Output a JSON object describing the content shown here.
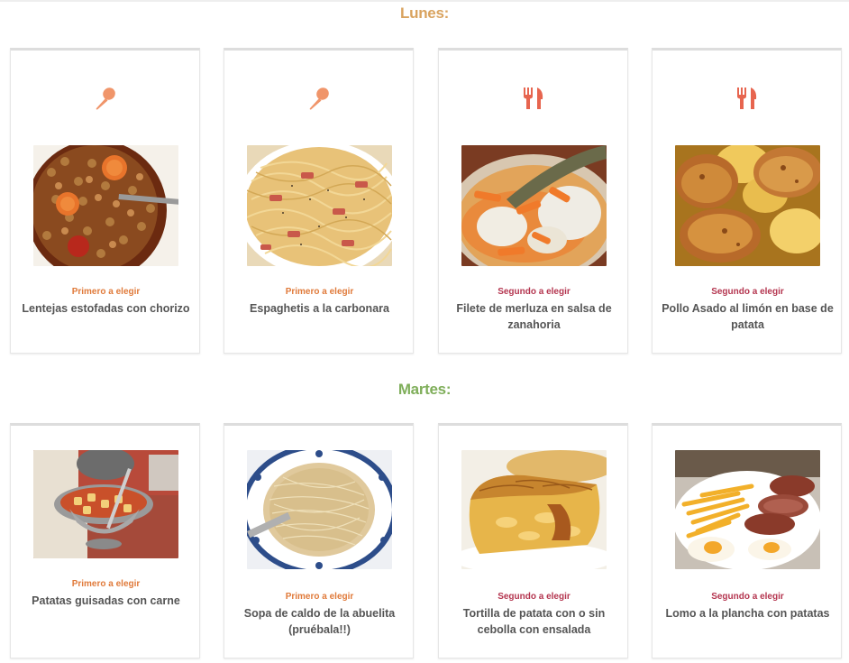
{
  "colors": {
    "lunes_heading": "#d9a35f",
    "martes_heading": "#7fae5a",
    "primero": "#e07a3a",
    "segundo": "#b4354f",
    "spoon_icon": "#f0956a",
    "cutlery_icon": "#e7654f"
  },
  "days": [
    {
      "heading": "Lunes:",
      "dishes": [
        {
          "icon": "spoon-icon",
          "course": "Primero a elegir",
          "name": "Lentejas estofadas con chorizo",
          "photo": "lentils-photo"
        },
        {
          "icon": "spoon-icon",
          "course": "Primero a elegir",
          "name": "Espaghetis a la carbonara",
          "photo": "carbonara-photo"
        },
        {
          "icon": "fork-knife-icon",
          "course": "Segundo a elegir",
          "name": "Filete de merluza en salsa de zanahoria",
          "photo": "hake-photo"
        },
        {
          "icon": "fork-knife-icon",
          "course": "Segundo a elegir",
          "name": "Pollo Asado al limón en base de patata",
          "photo": "roast-chicken-photo"
        }
      ]
    },
    {
      "heading": "Martes:",
      "dishes": [
        {
          "course": "Primero a elegir",
          "name": "Patatas guisadas con carne",
          "photo": "potato-stew-photo"
        },
        {
          "course": "Primero a elegir",
          "name": "Sopa de caldo de la abuelita (pruébala!!)",
          "photo": "noodle-soup-photo"
        },
        {
          "course": "Segundo a elegir",
          "name": "Tortilla de patata con o sin cebolla con ensalada",
          "photo": "tortilla-photo"
        },
        {
          "course": "Segundo a elegir",
          "name": "Lomo a la plancha con patatas",
          "photo": "pork-loin-photo"
        }
      ]
    }
  ]
}
